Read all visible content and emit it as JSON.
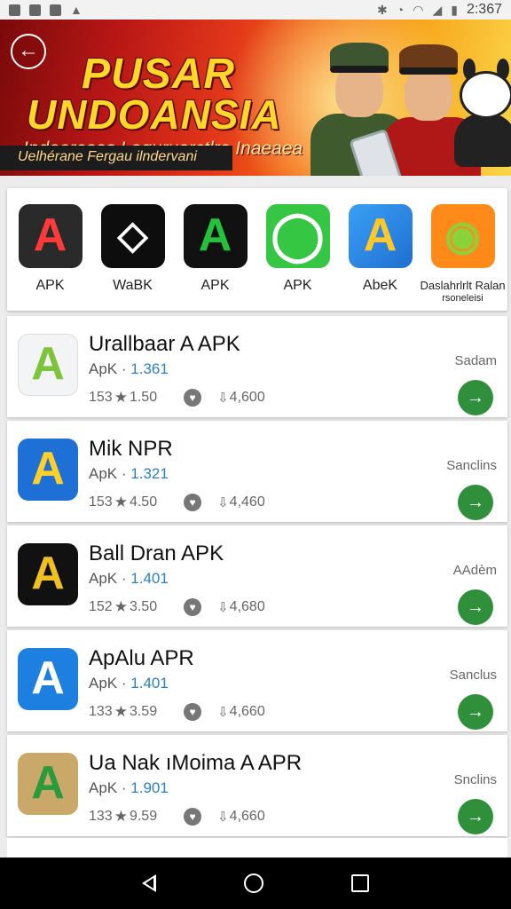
{
  "status_bar": {
    "time": "2:367"
  },
  "banner": {
    "title_line1": "PUSAR",
    "title_line2": "UNDOANSIA",
    "subtitle": "Indooresas Laguruarctlre Inaeaea",
    "tagline": "Uelhérane Fergau ilndervani"
  },
  "categories": [
    {
      "label": "APK",
      "icon": "apk-red-icon",
      "color": "#e23a2a"
    },
    {
      "label": "WaBK",
      "icon": "wabk-icon",
      "color": "#111111"
    },
    {
      "label": "APK",
      "icon": "apk-green-icon",
      "color": "#22c23a"
    },
    {
      "label": "APK",
      "icon": "whatsapp-style-icon",
      "color": "#2ec83e"
    },
    {
      "label": "AbeK",
      "icon": "abek-icon",
      "color": "#2d8ff0"
    },
    {
      "label": "Daslahrlrlt Ralan",
      "sublabel": "rsoneleisi",
      "icon": "android-icon",
      "color": "#ff8a1a"
    }
  ],
  "apps": [
    {
      "name": "Urallbaar A APK",
      "ver_prefix": "ApK ·",
      "version": "1.361",
      "count": "153",
      "rating": "1.50",
      "downloads": "4,600",
      "status": "Sadam"
    },
    {
      "name": "Mik NPR",
      "ver_prefix": "ApK ·",
      "version": "1.321",
      "count": "153",
      "rating": "4.50",
      "downloads": "4,460",
      "status": "Sanclins"
    },
    {
      "name": "Ball Dran APK",
      "ver_prefix": "ApK ·",
      "version": "1.401",
      "count": "152",
      "rating": "3.50",
      "downloads": "4,680",
      "status": "AAdèm"
    },
    {
      "name": "ApAlu APR",
      "ver_prefix": "ApK ·",
      "version": "1.401",
      "count": "133",
      "rating": "3.59",
      "downloads": "4,660",
      "status": "Sanclus"
    },
    {
      "name": "Ua Nak ıMoima A APR",
      "ver_prefix": "ApK ·",
      "version": "1.901",
      "count": "133",
      "rating": "9.59",
      "downloads": "4,660",
      "status": "Snclins"
    }
  ],
  "icons": {
    "back": "arrow-left-icon",
    "star": "★",
    "download": "download-arrow-icon"
  }
}
